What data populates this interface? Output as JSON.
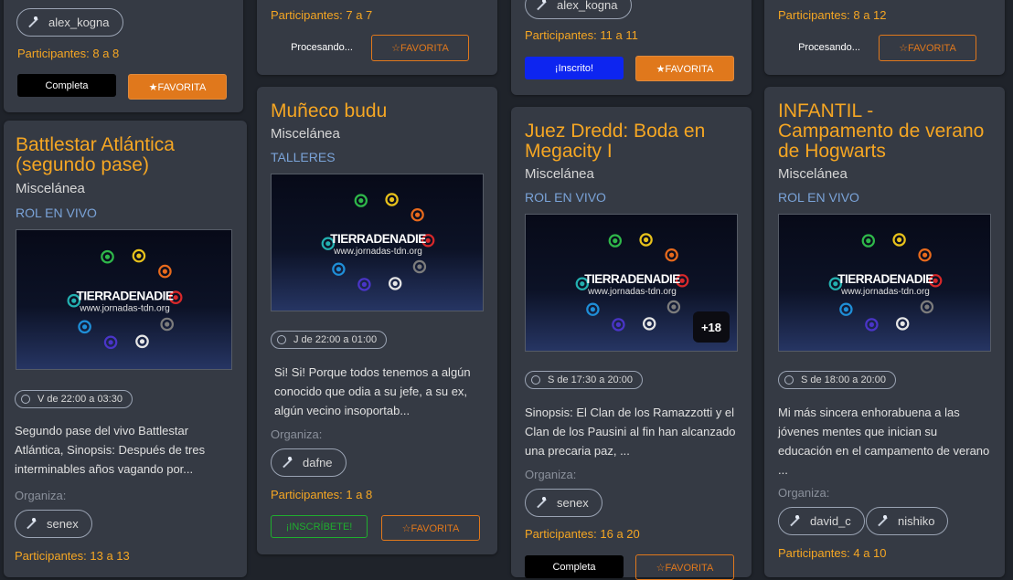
{
  "organiza_label": "Organiza:",
  "fav_label": "☆FAVORITA",
  "fav_active_label": "★FAVORITA",
  "logo": {
    "line1": "TIERRADENADIE",
    "line2": "www.jornadas-tdn.org"
  },
  "colors": {
    "accent": "#f5a623",
    "type": "#7aa3d8",
    "favorite": "#e0781c",
    "signup": "#1fae2e",
    "joined": "#0d25f0"
  },
  "cards": {
    "c1_top": {
      "user": "alex_kogna",
      "participants": "Participantes: 8 a 8",
      "status": "Completa"
    },
    "c2_top": {
      "participants": "Participantes: 7 a 7",
      "status": "Procesando..."
    },
    "c3_top": {
      "user": "alex_kogna",
      "participants": "Participantes: 11 a 11",
      "status": "¡Inscrito!"
    },
    "c4_top": {
      "participants": "Participantes: 8 a 12",
      "status": "Procesando..."
    },
    "battlestar": {
      "title_1": "Battlestar Atlántica",
      "title_2": "(segundo pase)",
      "category": "Miscelánea",
      "type": "ROL EN VIVO",
      "time": "V de 22:00 a 03:30",
      "desc_1": "Segundo pase del vivo Battlestar",
      "desc_2": "Atlántica, Sinopsis: Después de tres",
      "desc_3": "interminables años vagando por...",
      "user": "senex",
      "participants": "Participantes: 13 a 13"
    },
    "muneco": {
      "title": "Muñeco budu",
      "category": "Miscelánea",
      "type": "TALLERES",
      "time": "J de 22:00 a 01:00",
      "desc_1": "Si! Si! Porque todos tenemos a algún",
      "desc_2": "conocido que odia a su jefe, a su ex,",
      "desc_3": "algún vecino insoportab...",
      "user": "dafne",
      "participants": "Participantes: 1 a 8",
      "signup": "¡INSCRÍBETE!"
    },
    "dredd": {
      "title_1": "Juez Dredd: Boda en",
      "title_2": "Megacity I",
      "category": "Miscelánea",
      "type": "ROL EN VIVO",
      "badge": "+18",
      "time": "S de 17:30 a 20:00",
      "desc_1": "Sinopsis: El Clan de los Ramazzotti y el",
      "desc_2": "Clan de los Pausini al fin han alcanzado",
      "desc_3": "una precaria paz, ...",
      "user": "senex",
      "participants": "Participantes: 16 a 20",
      "status": "Completa"
    },
    "infantil": {
      "title_1": "INFANTIL -",
      "title_2": "Campamento de verano",
      "title_3": "de Hogwarts",
      "category": "Miscelánea",
      "type": "ROL EN VIVO",
      "time": "S de 18:00 a 20:00",
      "desc_1": "Mi más sincera enhorabuena a las",
      "desc_2": "jóvenes mentes que inician su",
      "desc_3": "educación en el campamento de verano",
      "desc_4": "...",
      "user_1": "david_c",
      "user_2": "nishiko",
      "participants": "Participantes: 4 a 10"
    }
  }
}
